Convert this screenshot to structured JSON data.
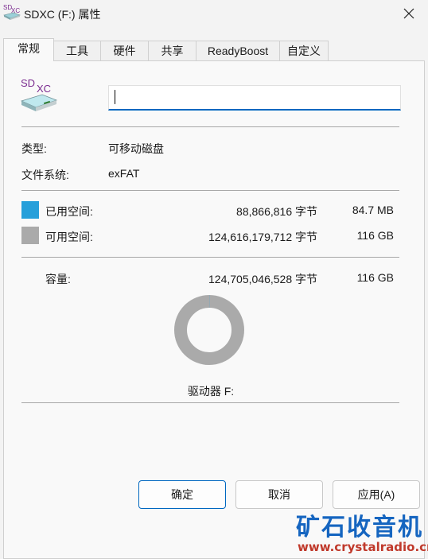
{
  "window": {
    "title": "SDXC (F:) 属性"
  },
  "tabs": [
    {
      "label": "常规",
      "active": true
    },
    {
      "label": "工具"
    },
    {
      "label": "硬件"
    },
    {
      "label": "共享"
    },
    {
      "label": "ReadyBoost"
    },
    {
      "label": "自定义"
    }
  ],
  "general": {
    "drive_icon_text": "SDXC",
    "volume_name": "",
    "type_label": "类型:",
    "type_value": "可移动磁盘",
    "fs_label": "文件系统:",
    "fs_value": "exFAT",
    "used": {
      "label": "已用空间:",
      "bytes": "88,866,816 字节",
      "size": "84.7 MB",
      "color": "#26a0da"
    },
    "free": {
      "label": "可用空间:",
      "bytes": "124,616,179,712 字节",
      "size": "116 GB",
      "color": "#aaaaaa"
    },
    "capacity": {
      "label": "容量:",
      "bytes": "124,705,046,528 字节",
      "size": "116 GB"
    },
    "used_fraction": 0.0007,
    "drive_label": "驱动器 F:"
  },
  "buttons": {
    "ok": "确定",
    "cancel": "取消",
    "apply": "应用(A)"
  },
  "watermark": {
    "text": "矿石收音机",
    "url": "www.crystalradio.cn"
  }
}
